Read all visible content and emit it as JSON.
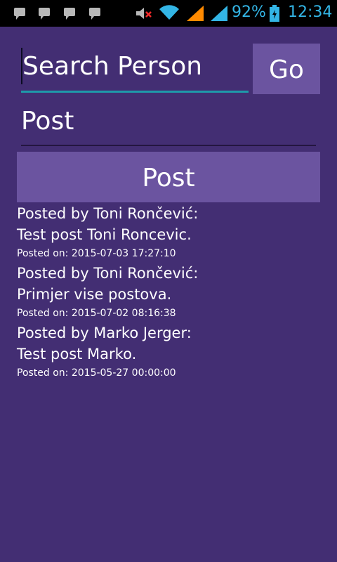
{
  "status_bar": {
    "battery": "92%",
    "time": "12:34",
    "colors": {
      "accent": "#33b5e5",
      "muted": "#ff2a2a"
    }
  },
  "search": {
    "value": "Search Person",
    "go_label": "Go"
  },
  "compose": {
    "value": "Post",
    "button_label": "Post"
  },
  "posts": [
    {
      "author": "Posted by Toni Rončević:",
      "content": "Test post Toni Roncevic.",
      "date": "Posted on: 2015-07-03 17:27:10"
    },
    {
      "author": "Posted by Toni Rončević:",
      "content": "Primjer vise postova.",
      "date": "Posted on: 2015-07-02 08:16:38"
    },
    {
      "author": "Posted by Marko Jerger:",
      "content": "Test post Marko.",
      "date": "Posted on: 2015-05-27 00:00:00"
    }
  ],
  "theme": {
    "background": "#432e73",
    "button": "#6b54a0",
    "focus_line": "#1e9aaa"
  }
}
